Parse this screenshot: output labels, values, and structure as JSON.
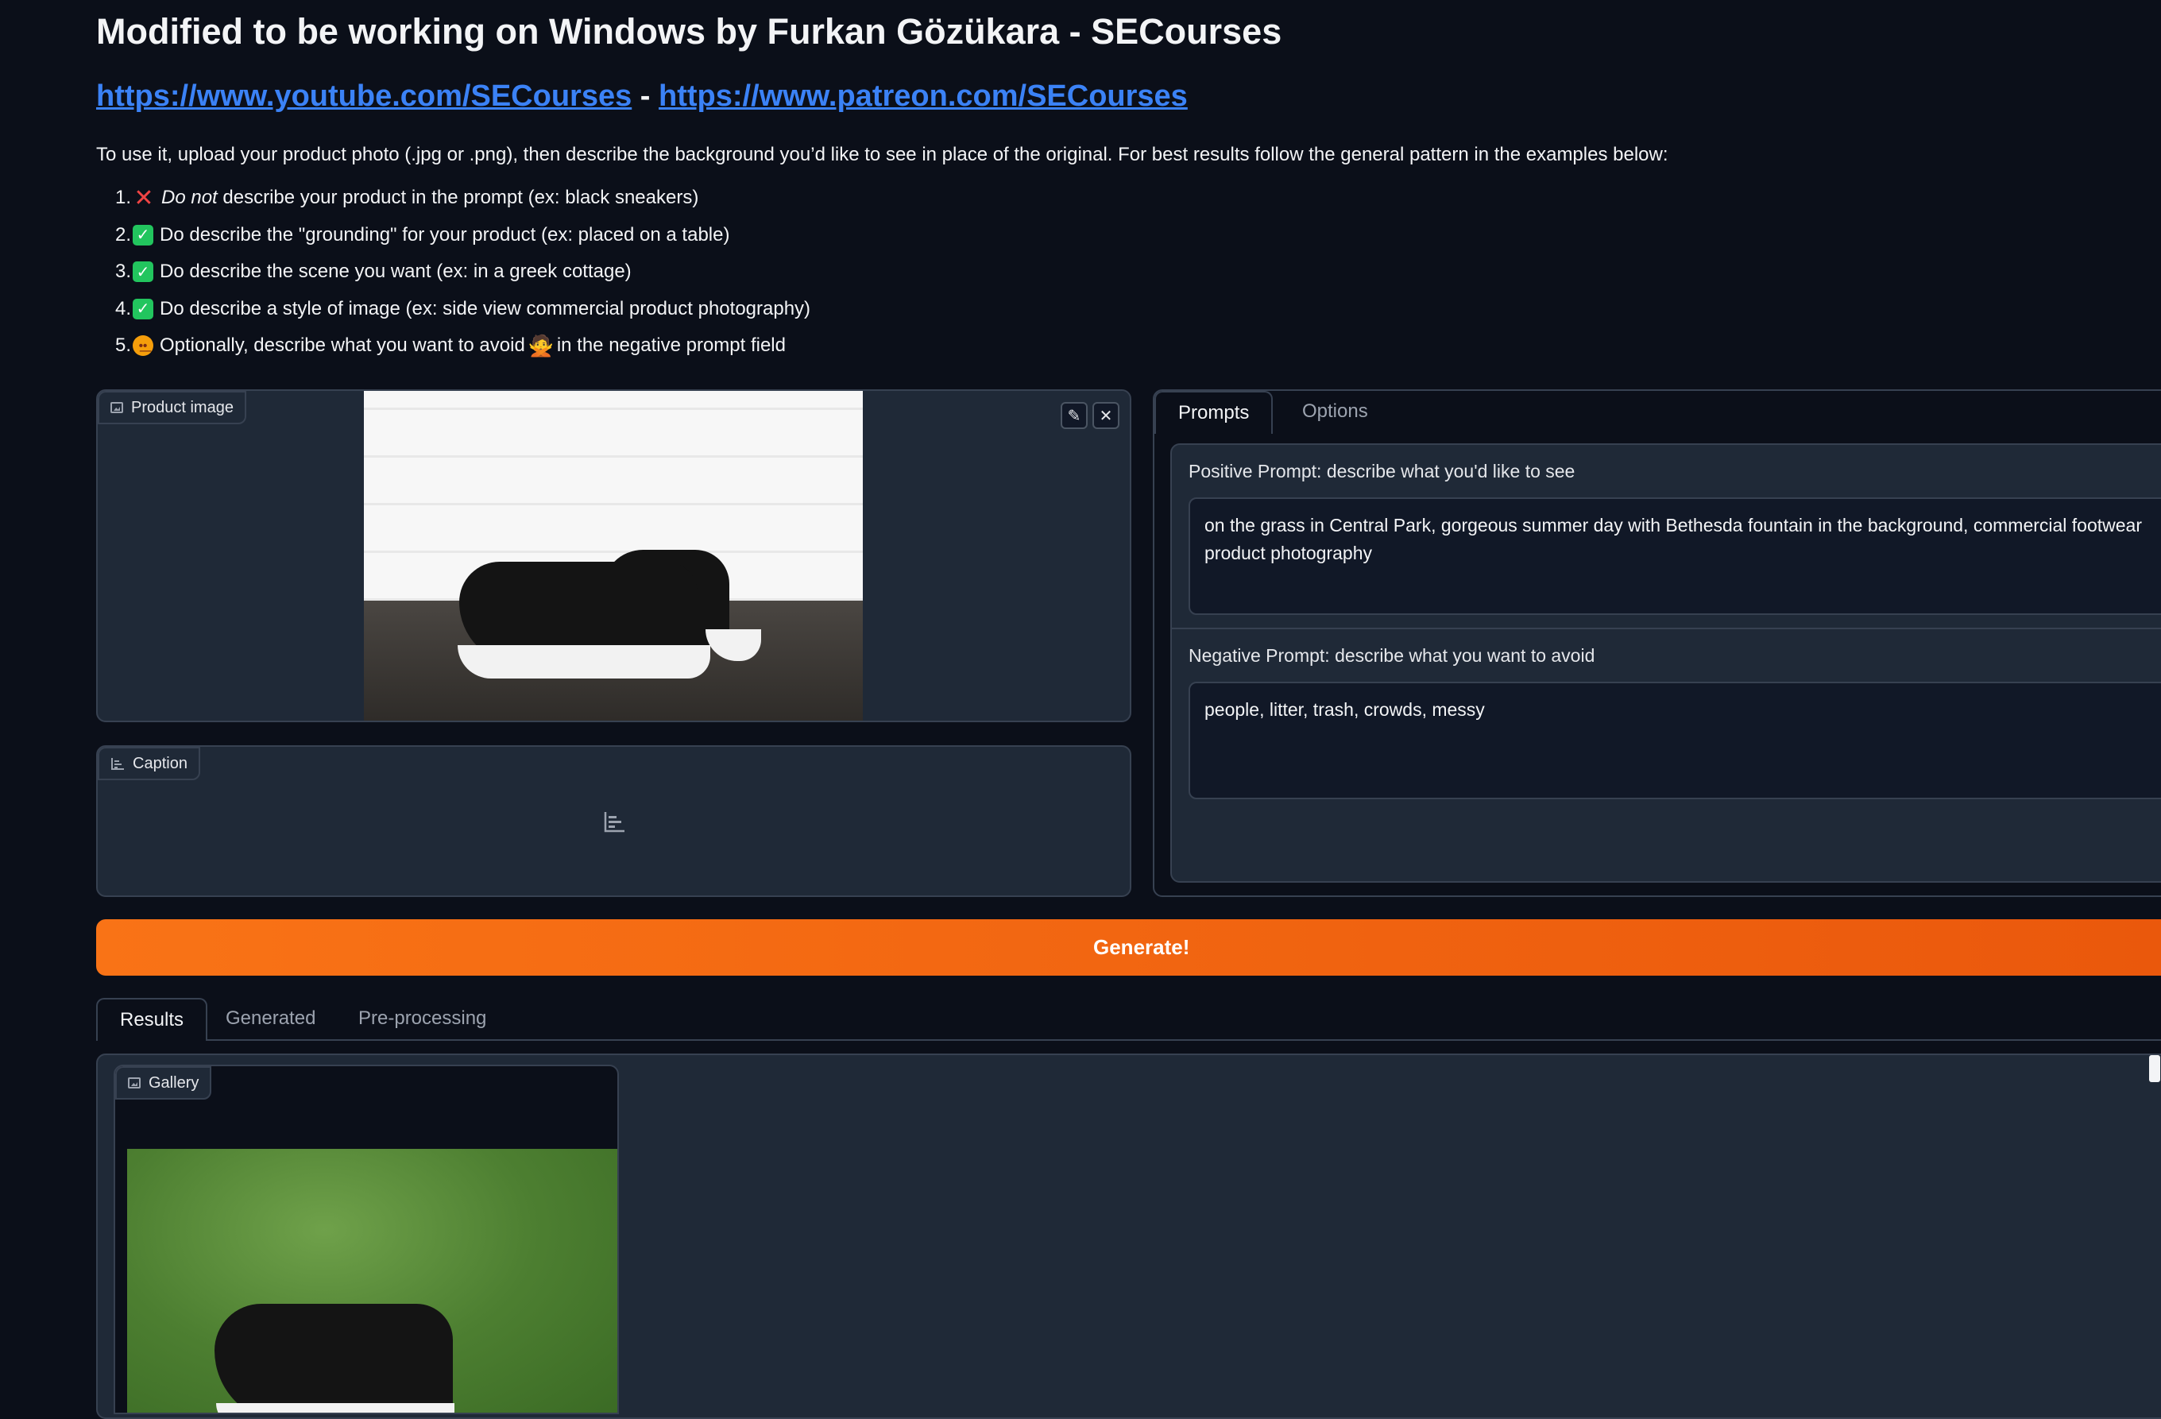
{
  "header": {
    "title": "Modified to be working on Windows by Furkan Gözükara - SECourses",
    "link_youtube": "https://www.youtube.com/SECourses",
    "link_separator": "-",
    "link_patreon": "https://www.patreon.com/SECourses",
    "intro": "To use it, upload your product photo (.jpg or .png), then describe the background you’d like to see in place of the original. For best results follow the general pattern in the examples below:"
  },
  "tips": [
    {
      "num": "1.",
      "icon": "cross-mark-icon",
      "emphasis": "Do not",
      "text": " describe your product in the prompt (ex: black sneakers)"
    },
    {
      "num": "2.",
      "icon": "check-mark-icon",
      "text": "Do describe the \"grounding\" for your product (ex: placed on a table)"
    },
    {
      "num": "3.",
      "icon": "check-mark-icon",
      "text": "Do describe the scene you want (ex: in a greek cottage)"
    },
    {
      "num": "4.",
      "icon": "check-mark-icon",
      "text": "Do describe a style of image (ex: side view commercial product photography)"
    },
    {
      "num": "5.",
      "icon": "thinking-face-icon",
      "text_before": "Optionally, describe what you want to avoid",
      "text_after": "in the negative prompt field"
    }
  ],
  "product_image": {
    "label": "Product image"
  },
  "caption": {
    "label": "Caption"
  },
  "prompt_tabs": [
    "Prompts",
    "Options"
  ],
  "positive_prompt": {
    "label": "Positive Prompt: describe what you'd like to see",
    "value": "on the grass in Central Park, gorgeous summer day with Bethesda fountain in the background, commercial footwear product photography"
  },
  "negative_prompt": {
    "label": "Negative Prompt: describe what you want to avoid",
    "value": "people, litter, trash, crowds, messy"
  },
  "generate_label": "Generate!",
  "result_tabs": [
    "Results",
    "Generated",
    "Pre-processing"
  ],
  "gallery": {
    "label": "Gallery"
  },
  "colors": {
    "accent": "#f97316",
    "link": "#3b82f6",
    "background": "#0b0f19",
    "panel": "#1f2937"
  }
}
